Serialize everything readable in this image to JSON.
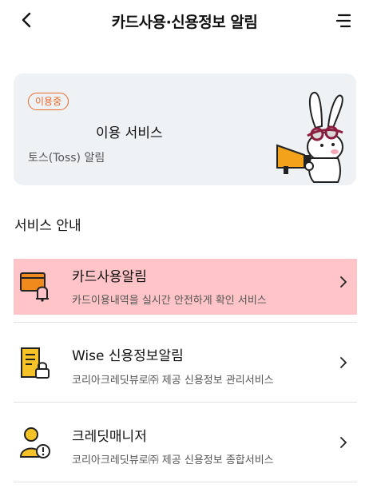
{
  "header": {
    "title": "카드사용·신용정보 알림"
  },
  "card": {
    "badge": "이용중",
    "service_title": "이용 서비스",
    "service_sub": "토스(Toss) 알림"
  },
  "section": {
    "title": "서비스 안내"
  },
  "items": [
    {
      "label": "카드사용알림",
      "desc": "카드이용내역을 실시간 안전하게 확인 서비스",
      "icon": "card-bell-icon"
    },
    {
      "label": "Wise 신용정보알림",
      "desc": "코리아크레딧뷰로㈜ 제공 신용정보 관리서비스",
      "icon": "document-lock-icon"
    },
    {
      "label": "크레딧매니저",
      "desc": "코리아크레딧뷰로㈜ 제공 신용정보 종합서비스",
      "icon": "person-alert-icon"
    }
  ],
  "colors": {
    "accent": "#e8692a",
    "highlight": "#ffc4c7",
    "icon_yellow": "#f5c227"
  }
}
